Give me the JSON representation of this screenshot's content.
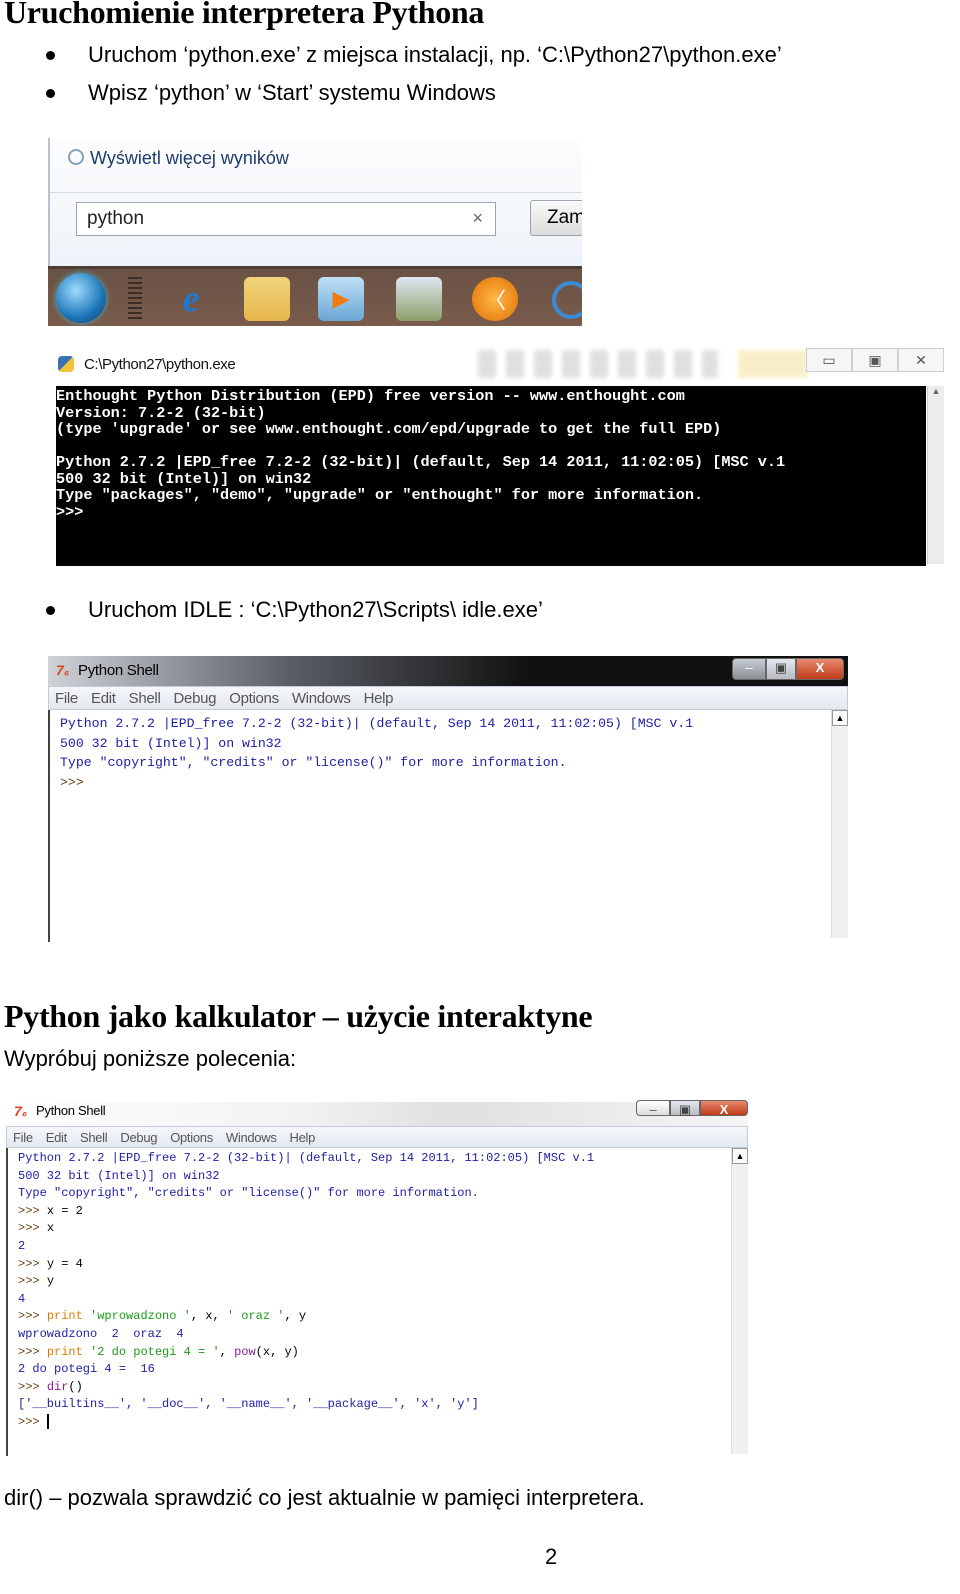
{
  "section1": {
    "heading": "Uruchomienie interpretera Pythona",
    "bullets": [
      "Uruchom ‘python.exe’ z miejsca instalacji, np. ‘C:\\Python27\\python.exe’",
      "Wpisz ‘python’ w ‘Start’ systemu Windows"
    ]
  },
  "start_menu": {
    "more_results": "Wyświetl więcej wyników",
    "search_value": "python",
    "clear_icon": "×",
    "shutdown_partial": "Zam",
    "taskbar_icons": [
      "windows-start-orb",
      "internet-explorer",
      "file-explorer",
      "media-player",
      "photo-gallery",
      "media-app",
      "unknown-app"
    ]
  },
  "console": {
    "title": "C:\\Python27\\python.exe",
    "controls": [
      "▭",
      "▣",
      "✕"
    ],
    "lines": [
      "Enthought Python Distribution (EPD) free version -- www.enthought.com",
      "Version: 7.2-2 (32-bit)",
      "(type 'upgrade' or see www.enthought.com/epd/upgrade to get the full EPD)",
      "",
      "Python 2.7.2 |EPD_free 7.2-2 (32-bit)| (default, Sep 14 2011, 11:02:05) [MSC v.1",
      "500 32 bit (Intel)] on win32",
      "Type \"packages\", \"demo\", \"upgrade\" or \"enthought\" for more information.",
      ">>>"
    ]
  },
  "section1b": {
    "bullet": "Uruchom IDLE :  ‘C:\\Python27\\Scripts\\ idle.exe’"
  },
  "idle1": {
    "title": "Python Shell",
    "menu": [
      "File",
      "Edit",
      "Shell",
      "Debug",
      "Options",
      "Windows",
      "Help"
    ],
    "controls": [
      "–",
      "▣",
      "X"
    ],
    "lines": [
      "Python 2.7.2 |EPD_free 7.2-2 (32-bit)| (default, Sep 14 2011, 11:02:05) [MSC v.1",
      "500 32 bit (Intel)] on win32",
      "Type \"copyright\", \"credits\" or \"license()\" for more information.",
      ">>>"
    ]
  },
  "section2": {
    "heading": "Python jako kalkulator – użycie interaktyne",
    "intro": "Wypróbuj poniższe polecenia:"
  },
  "idle2": {
    "title": "Python Shell",
    "menu": [
      "File",
      "Edit",
      "Shell",
      "Debug",
      "Options",
      "Windows",
      "Help"
    ],
    "controls": [
      "–",
      "▣",
      "X"
    ],
    "header_lines": [
      "Python 2.7.2 |EPD_free 7.2-2 (32-bit)| (default, Sep 14 2011, 11:02:05) [MSC v.1",
      "500 32 bit (Intel)] on win32",
      "Type \"copyright\", \"credits\" or \"license()\" for more information."
    ],
    "session": {
      "prompt": ">>> ",
      "l1": "x = 2",
      "l2": "x",
      "o2": "2",
      "l3": "y = 4",
      "l4": "y",
      "o4": "4",
      "l5_kw": "print",
      "l5_str1": "'wprowadzono '",
      "l5_mid": ", x, ",
      "l5_str2": "' oraz '",
      "l5_end": ", y",
      "o5": "wprowadzono  2  oraz  4",
      "l6_kw": "print",
      "l6_str": "'2 do potegi 4 = '",
      "l6_mid": ", ",
      "l6_fn": "pow",
      "l6_end": "(x, y)",
      "o6": "2 do potegi 4 =  16",
      "l7_fn": "dir",
      "l7_end": "()",
      "o7": "['__builtins__', '__doc__', '__name__', '__package__', 'x', 'y']",
      "last_prompt": ">>> "
    }
  },
  "footer": {
    "note": "dir() – pozwala sprawdzić co jest aktualnie w pamięci interpretera.",
    "page_number": "2"
  }
}
